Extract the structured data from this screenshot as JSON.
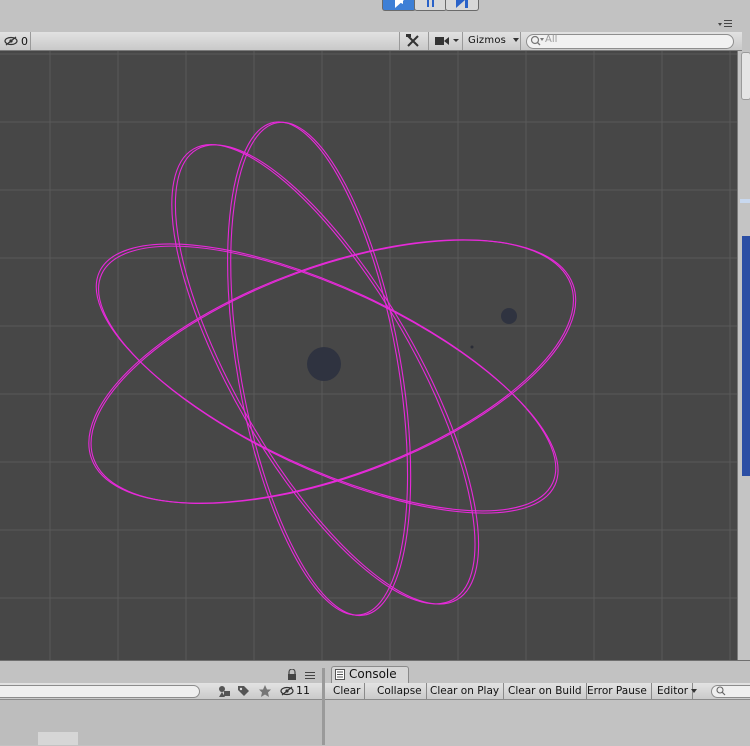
{
  "toolbar": {
    "hidden_count": "0",
    "gizmos_label": "Gizmos",
    "search_placeholder": "All"
  },
  "scene": {
    "orbit_color": "#e62ad9",
    "body_color": "#2f3340"
  },
  "project": {
    "hidden_count": "11"
  },
  "console": {
    "tab_title": "Console",
    "buttons": [
      "Clear",
      "Collapse",
      "Clear on Play",
      "Clear on Build",
      "Error Pause",
      "Editor"
    ]
  }
}
